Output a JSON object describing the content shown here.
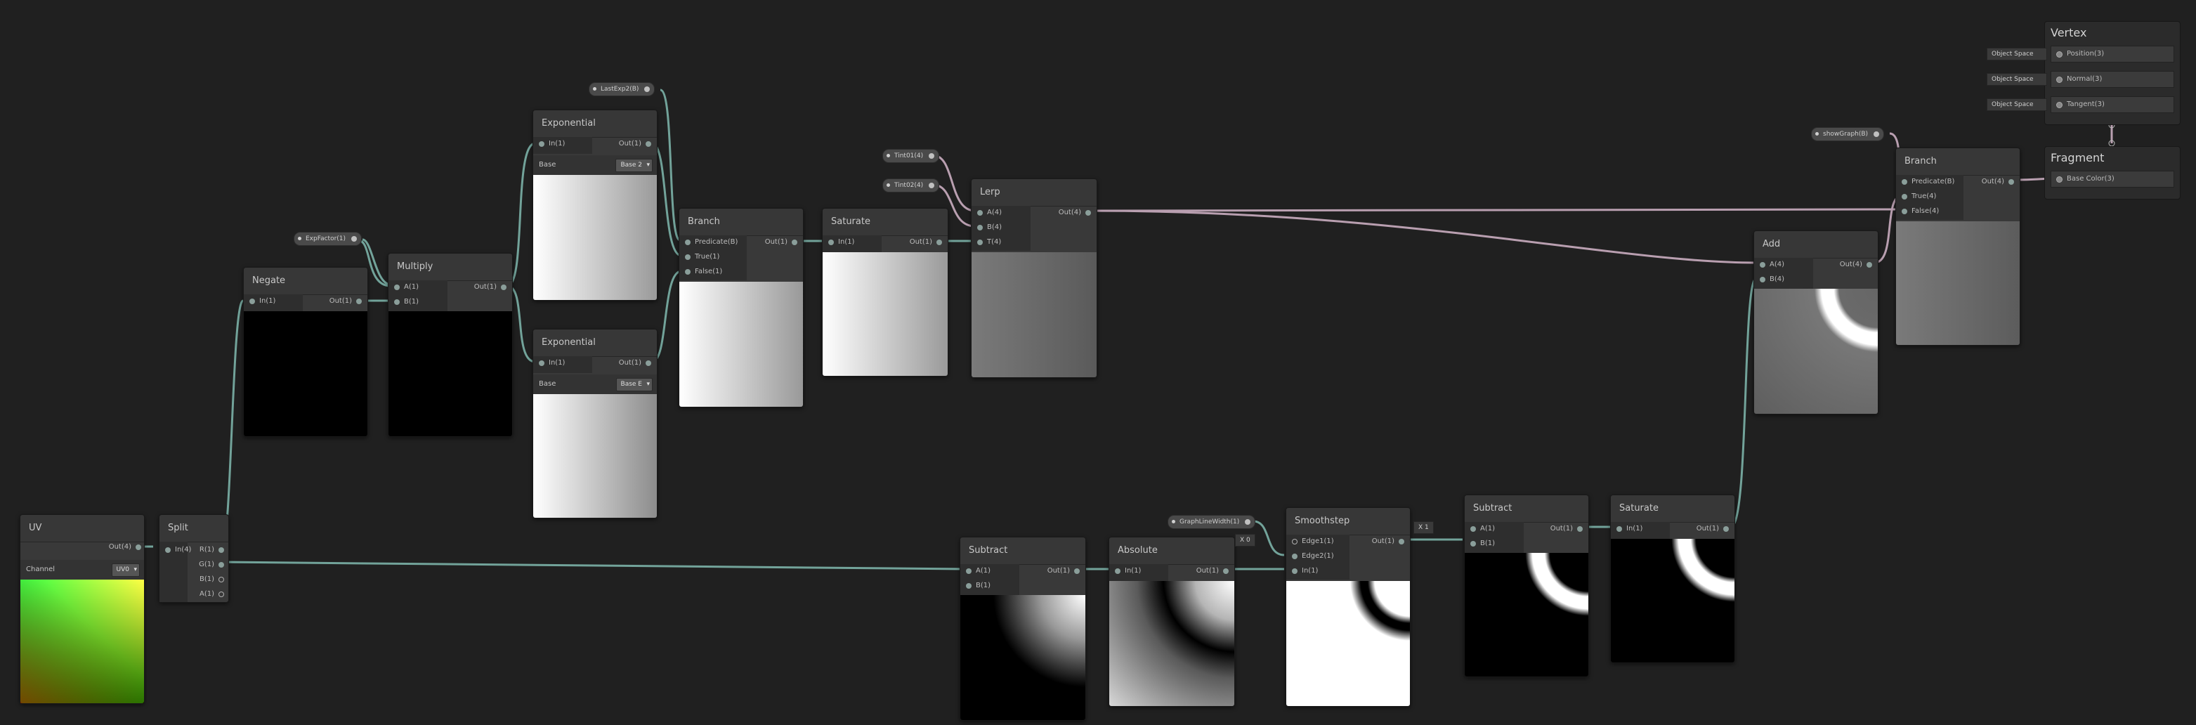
{
  "colors": {
    "background": "#202020",
    "wire_vector": "#72a39a",
    "wire_multi": "#b99fb0"
  },
  "properties": {
    "expFactor": "ExpFactor(1)",
    "lastExp": "LastExp2(B)",
    "tint1": "Tint01(4)",
    "tint2": "Tint02(4)",
    "lineWidth": "GraphLineWidth(1)",
    "showGraph": "showGraph(B)"
  },
  "nodes": {
    "uv": {
      "title": "UV",
      "out": "Out(4)",
      "channel_label": "Channel",
      "channel_value": "UV0"
    },
    "split": {
      "title": "Split",
      "in": "In(4)",
      "outs": [
        "R(1)",
        "G(1)",
        "B(1)",
        "A(1)"
      ]
    },
    "negate": {
      "title": "Negate",
      "in": "In(1)",
      "out": "Out(1)"
    },
    "multiply": {
      "title": "Multiply",
      "ins": [
        "A(1)",
        "B(1)"
      ],
      "out": "Out(1)"
    },
    "exp1": {
      "title": "Exponential",
      "in": "In(1)",
      "out": "Out(1)",
      "base_label": "Base",
      "base_value": "Base 2"
    },
    "exp2": {
      "title": "Exponential",
      "in": "In(1)",
      "out": "Out(1)",
      "base_label": "Base",
      "base_value": "Base E"
    },
    "branch1": {
      "title": "Branch",
      "ins": [
        "Predicate(B)",
        "True(1)",
        "False(1)"
      ],
      "out": "Out(1)"
    },
    "saturate1": {
      "title": "Saturate",
      "in": "In(1)",
      "out": "Out(1)"
    },
    "lerp": {
      "title": "Lerp",
      "ins": [
        "A(4)",
        "B(4)",
        "T(4)"
      ],
      "out": "Out(4)"
    },
    "subtract1": {
      "title": "Subtract",
      "ins": [
        "A(1)",
        "B(1)"
      ],
      "out": "Out(1)"
    },
    "absolute": {
      "title": "Absolute",
      "in": "In(1)",
      "out": "Out(1)",
      "x_label": "X",
      "x_value": "0"
    },
    "smoothstep": {
      "title": "Smoothstep",
      "ins": [
        "Edge1(1)",
        "Edge2(1)",
        "In(1)"
      ],
      "out": "Out(1)",
      "x_label": "X",
      "x_value": "1"
    },
    "subtract2": {
      "title": "Subtract",
      "ins": [
        "A(1)",
        "B(1)"
      ],
      "out": "Out(1)"
    },
    "saturate2": {
      "title": "Saturate",
      "in": "In(1)",
      "out": "Out(1)"
    },
    "add": {
      "title": "Add",
      "ins": [
        "A(4)",
        "B(4)"
      ],
      "out": "Out(4)"
    },
    "branch2": {
      "title": "Branch",
      "ins": [
        "Predicate(B)",
        "True(4)",
        "False(4)"
      ],
      "out": "Out(4)"
    }
  },
  "master": {
    "vertex": {
      "title": "Vertex",
      "slots": [
        "Position(3)",
        "Normal(3)",
        "Tangent(3)"
      ],
      "space": "Object Space"
    },
    "fragment": {
      "title": "Fragment",
      "slots": [
        "Base Color(3)"
      ]
    }
  }
}
